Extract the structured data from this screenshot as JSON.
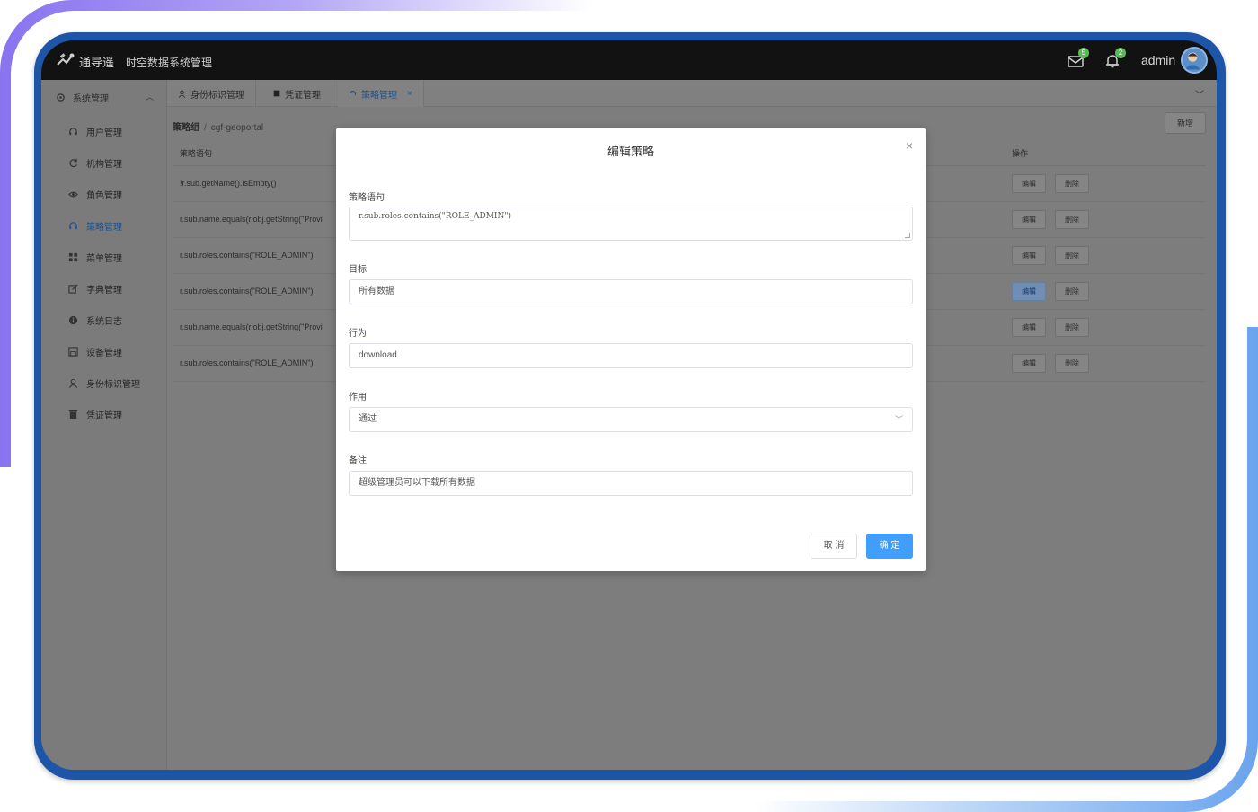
{
  "header": {
    "brand": "通导遥",
    "subtitle": "时空数据系统管理",
    "mail_badge": "5",
    "bell_badge": "2",
    "username": "admin"
  },
  "sidebar": {
    "group_label": "系统管理",
    "items": [
      {
        "label": "用户管理",
        "icon": "headset-icon"
      },
      {
        "label": "机构管理",
        "icon": "refresh-icon"
      },
      {
        "label": "角色管理",
        "icon": "eye-icon"
      },
      {
        "label": "策略管理",
        "icon": "headset-icon",
        "active": true
      },
      {
        "label": "菜单管理",
        "icon": "grid-icon"
      },
      {
        "label": "字典管理",
        "icon": "edit-icon"
      },
      {
        "label": "系统日志",
        "icon": "info-icon"
      },
      {
        "label": "设备管理",
        "icon": "save-icon"
      },
      {
        "label": "身份标识管理",
        "icon": "user-icon"
      },
      {
        "label": "凭证管理",
        "icon": "trash-icon"
      }
    ]
  },
  "tabs": [
    {
      "label": "身份标识管理",
      "icon": "user-icon"
    },
    {
      "label": "凭证管理",
      "icon": "trash-icon"
    },
    {
      "label": "策略管理",
      "icon": "headset-icon",
      "active": true,
      "close": "×"
    }
  ],
  "breadcrumb": {
    "root": "策略组",
    "sep": "/",
    "current": "cgf-geoportal"
  },
  "add_button": "新增",
  "table": {
    "col_statement": "策略语句",
    "col_actions": "操作",
    "edit_label": "编辑",
    "delete_label": "删除",
    "rows": [
      "!r.sub.getName().isEmpty()",
      "r.sub.name.equals(r.obj.getString(\"Provi",
      "r.sub.roles.contains(\"ROLE_ADMIN\")",
      "r.sub.roles.contains(\"ROLE_ADMIN\")",
      "r.sub.name.equals(r.obj.getString(\"Provi",
      "r.sub.roles.contains(\"ROLE_ADMIN\")"
    ]
  },
  "modal": {
    "title": "编辑策略",
    "close": "×",
    "statement_label": "策略语句",
    "statement_value": "r.sub.roles.contains(\"ROLE_ADMIN\")",
    "target_label": "目标",
    "target_value": "所有数据",
    "action_label": "行为",
    "action_value": "download",
    "effect_label": "作用",
    "effect_value": "通过",
    "remark_label": "备注",
    "remark_value": "超级管理员可以下载所有数据",
    "cancel_label": "取 消",
    "ok_label": "确 定"
  },
  "colors": {
    "primary": "#409eff",
    "header_bg": "#121212",
    "frame": "#1d55a8"
  }
}
